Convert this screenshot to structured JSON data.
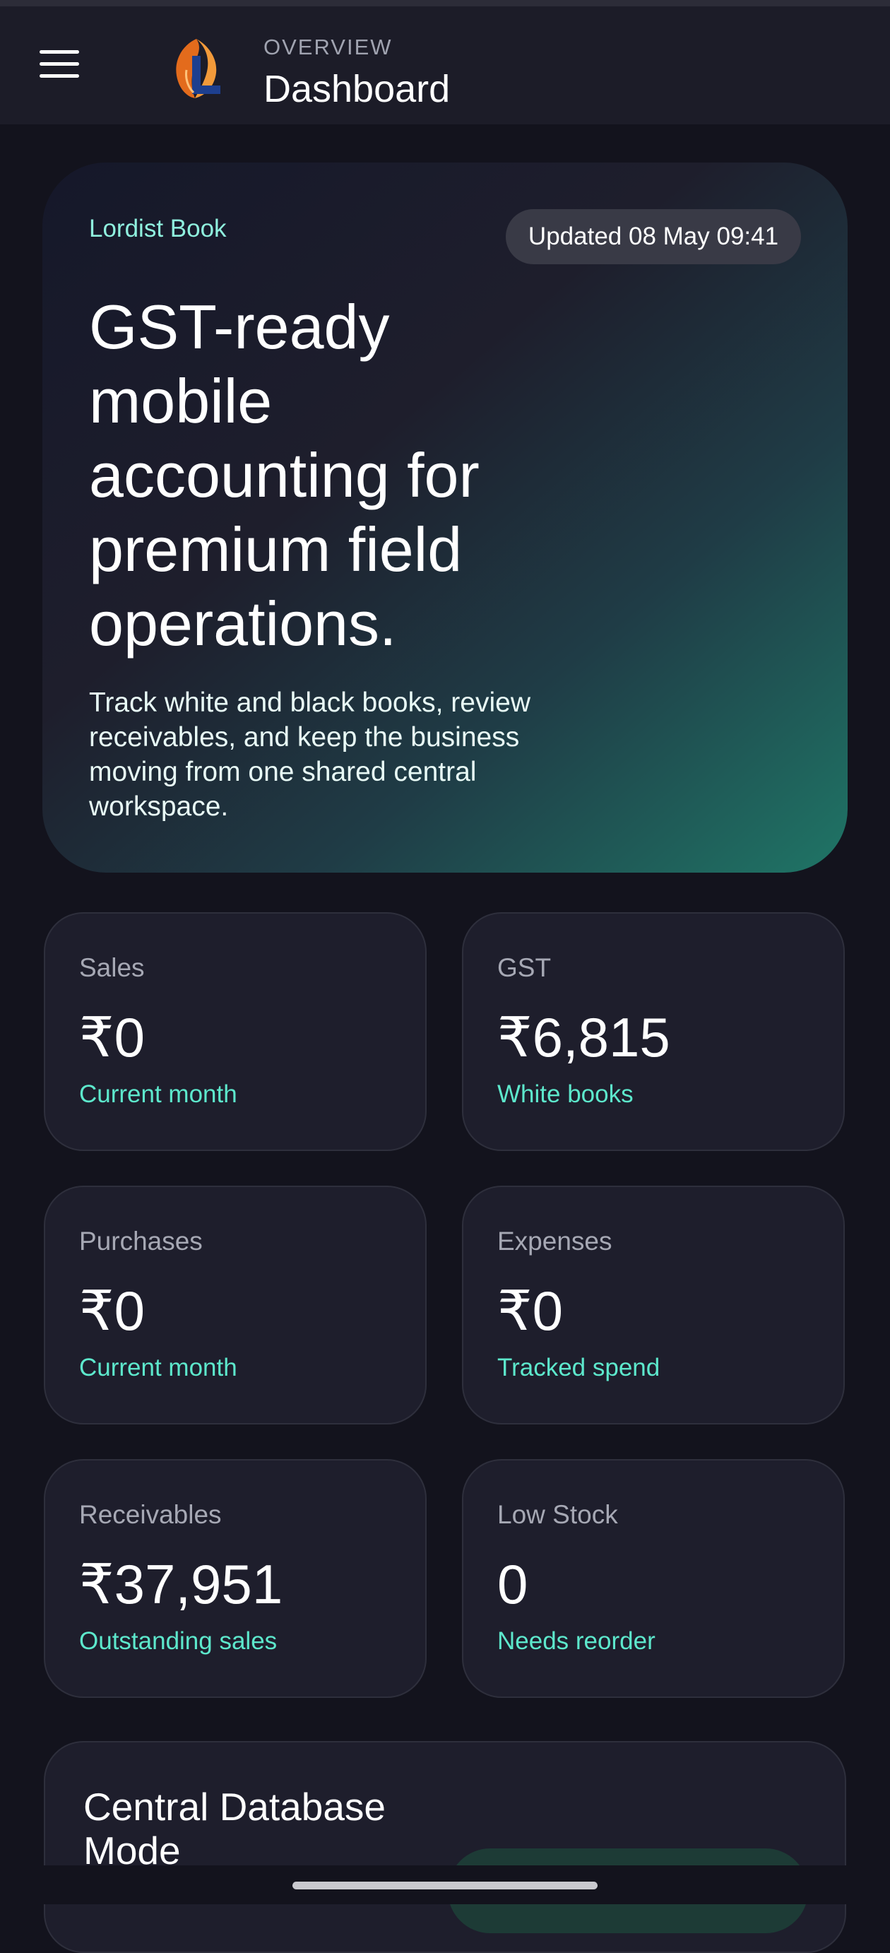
{
  "app_bar": {
    "kicker": "OVERVIEW",
    "title": "Dashboard"
  },
  "icons": {
    "menu": "hamburger-menu-icon",
    "logo": "shell-logo-icon"
  },
  "hero": {
    "brand": "Lordist Book",
    "updated": "Updated 08 May 09:41",
    "headline": "GST-ready mobile accounting for premium field operations.",
    "body": "Track white and black books, review receivables, and keep the business moving from one shared central workspace."
  },
  "stats": [
    {
      "label": "Sales",
      "value": "₹0",
      "caption": "Current month"
    },
    {
      "label": "GST",
      "value": "₹6,815",
      "caption": "White books"
    },
    {
      "label": "Purchases",
      "value": "₹0",
      "caption": "Current month"
    },
    {
      "label": "Expenses",
      "value": "₹0",
      "caption": "Tracked spend"
    },
    {
      "label": "Receivables",
      "value": "₹37,951",
      "caption": "Outstanding sales"
    },
    {
      "label": "Low Stock",
      "value": "0",
      "caption": "Needs reorder"
    }
  ],
  "db_card": {
    "title": "Central Database Mode"
  },
  "colors": {
    "background": "#13131d",
    "card": "#1e1e2c",
    "accent": "#5de8cc",
    "hero_accent": "#1f7566"
  }
}
